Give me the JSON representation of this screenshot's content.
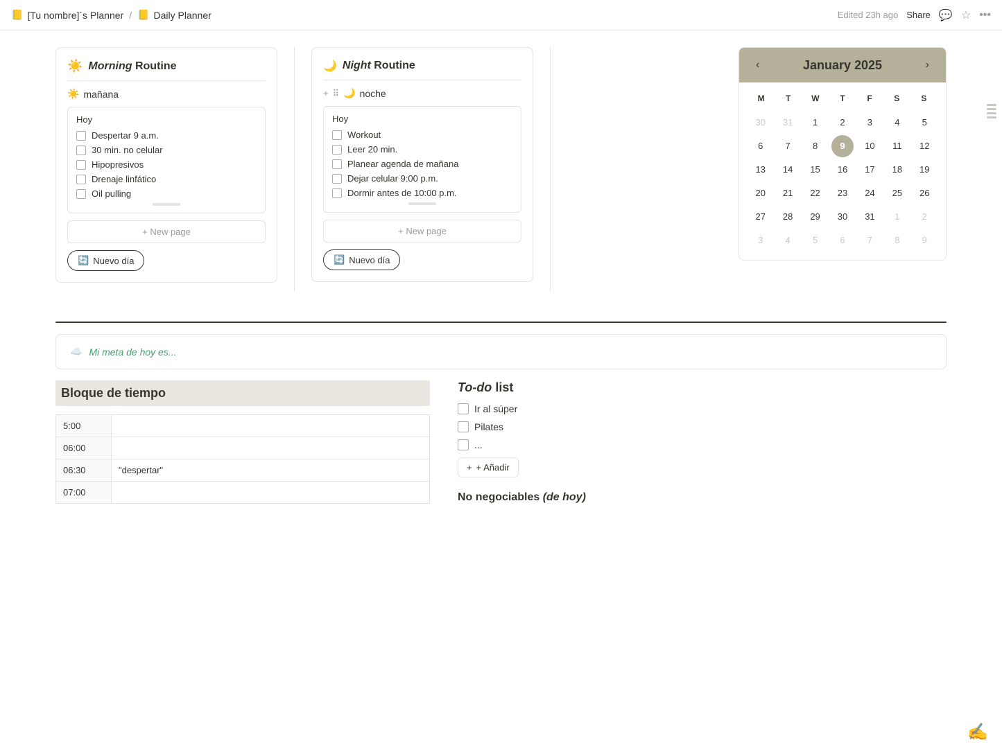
{
  "header": {
    "breadcrumb_icon": "📒",
    "breadcrumb_parent": "[Tu nombre]´s Planner",
    "breadcrumb_separator": "/",
    "breadcrumb_icon2": "📒",
    "page_title": "Daily Planner",
    "edited_text": "Edited 23h ago",
    "share_label": "Share"
  },
  "morning_routine": {
    "icon": "☀️",
    "title_italic": "Morning",
    "title_rest": " Routine",
    "subtitle_icon": "☀️",
    "subtitle_text": "mañana",
    "today_label": "Hoy",
    "checklist": [
      "Despertar 9 a.m.",
      "30 min. no celular",
      "Hipopresivos",
      "Drenaje linfático",
      "Oil pulling"
    ],
    "new_page_label": "+ New page",
    "nuevo_dia_label": "Nuevo día"
  },
  "night_routine": {
    "icon": "🌙",
    "title_italic": "Night",
    "title_rest": " Routine",
    "subtitle_icon": "🌙",
    "subtitle_text": "noche",
    "today_label": "Hoy",
    "checklist": [
      "Workout",
      "Leer 20 min.",
      "Planear agenda de mañana",
      "Dejar celular 9:00 p.m.",
      "Dormir antes de 10:00 p.m."
    ],
    "new_page_label": "+ New page",
    "nuevo_dia_label": "Nuevo día"
  },
  "calendar": {
    "title": "January 2025",
    "prev_label": "‹",
    "next_label": "›",
    "day_names": [
      "M",
      "T",
      "W",
      "T",
      "F",
      "S",
      "S"
    ],
    "weeks": [
      [
        {
          "num": "30",
          "inactive": true
        },
        {
          "num": "31",
          "inactive": true
        },
        {
          "num": "1"
        },
        {
          "num": "2"
        },
        {
          "num": "3"
        },
        {
          "num": "4"
        },
        {
          "num": "5"
        }
      ],
      [
        {
          "num": "6"
        },
        {
          "num": "7"
        },
        {
          "num": "8"
        },
        {
          "num": "9",
          "today": true
        },
        {
          "num": "10"
        },
        {
          "num": "11"
        },
        {
          "num": "12"
        }
      ],
      [
        {
          "num": "13"
        },
        {
          "num": "14"
        },
        {
          "num": "15"
        },
        {
          "num": "16"
        },
        {
          "num": "17"
        },
        {
          "num": "18"
        },
        {
          "num": "19"
        }
      ],
      [
        {
          "num": "20"
        },
        {
          "num": "21"
        },
        {
          "num": "22"
        },
        {
          "num": "23"
        },
        {
          "num": "24"
        },
        {
          "num": "25"
        },
        {
          "num": "26"
        }
      ],
      [
        {
          "num": "27"
        },
        {
          "num": "28"
        },
        {
          "num": "29"
        },
        {
          "num": "30"
        },
        {
          "num": "31"
        },
        {
          "num": "1",
          "inactive": true
        },
        {
          "num": "2",
          "inactive": true
        }
      ],
      [
        {
          "num": "3",
          "inactive": true
        },
        {
          "num": "4",
          "inactive": true
        },
        {
          "num": "5",
          "inactive": true
        },
        {
          "num": "6",
          "inactive": true
        },
        {
          "num": "7",
          "inactive": true
        },
        {
          "num": "8",
          "inactive": true
        },
        {
          "num": "9",
          "inactive": true
        }
      ]
    ]
  },
  "goal": {
    "icon": "☁️",
    "text": "Mi meta de hoy es..."
  },
  "time_block": {
    "title": "Bloque de tiempo",
    "rows": [
      {
        "time": "5:00",
        "event": ""
      },
      {
        "time": "06:00",
        "event": ""
      },
      {
        "time": "06:30",
        "event": "\"despertar\""
      },
      {
        "time": "07:00",
        "event": ""
      }
    ]
  },
  "todo": {
    "title_italic": "To-do",
    "title_rest": " list",
    "items": [
      "Ir al súper",
      "Pilates",
      "..."
    ],
    "add_label": "+ Añadir",
    "no_neg_italic": "No negociables",
    "no_neg_rest": " (de hoy)"
  }
}
